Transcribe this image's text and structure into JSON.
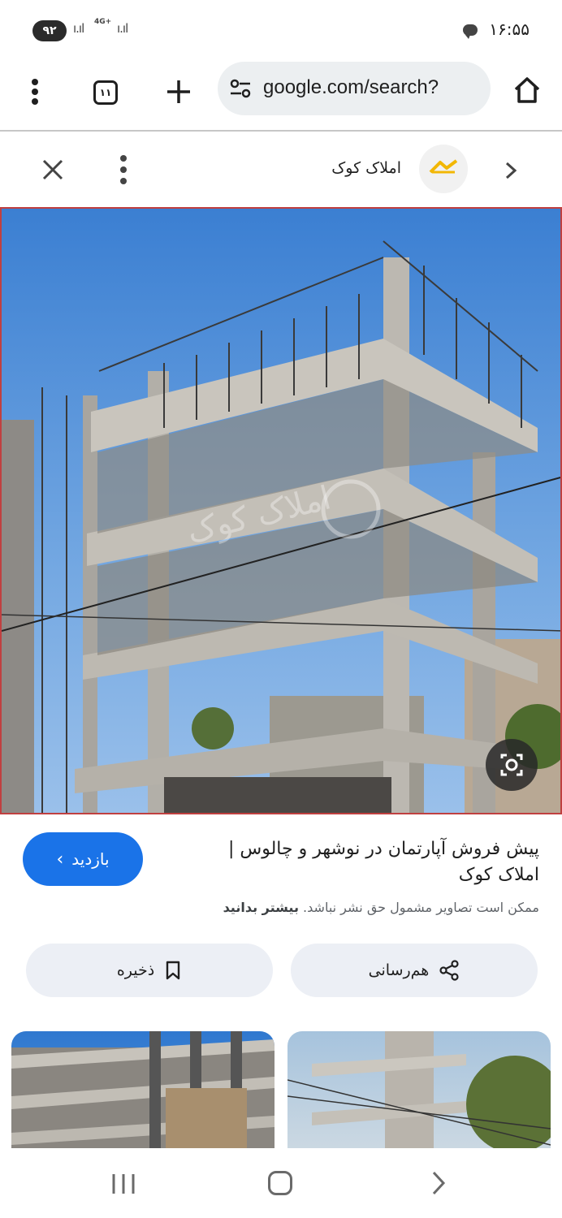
{
  "status_bar": {
    "battery": "۹۲",
    "network": "4G+",
    "time": "۱۶:۵۵"
  },
  "browser": {
    "tab_count": "۱۱",
    "url": "google.com/search?"
  },
  "viewer": {
    "site_name": "املاک کوک",
    "watermark": "املاک کوک"
  },
  "result": {
    "visit_label": "بازدید",
    "title": "پیش فروش آپارتمان در نوشهر و چالوس | املاک کوک",
    "copyright_notice": "ممکن است تصاویر مشمول حق نشر نباشد.",
    "learn_more": "بیشتر بدانید"
  },
  "actions": {
    "share_label": "هم‌رسانی",
    "save_label": "ذخیره"
  },
  "colors": {
    "accent": "#1a73e8",
    "pill_bg": "#eceff5",
    "omnibox_bg": "#eceff1"
  }
}
